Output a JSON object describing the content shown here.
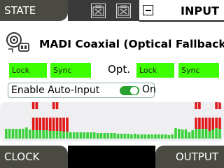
{
  "tabs": {
    "state": "STATE",
    "clock": "CLOCK",
    "output": "OUTPUT",
    "input": "INPUT"
  },
  "device": {
    "name": "MADI Coaxial (Optical Fallback)",
    "icon": "coaxial-connector-icon"
  },
  "status": {
    "primary": [
      "Lock",
      "Sync"
    ],
    "optical_label": "Opt.",
    "optical": [
      "Lock",
      "Sync"
    ]
  },
  "auto_input": {
    "label": "Enable Auto-Input",
    "state": "On",
    "enabled": true
  },
  "colors": {
    "tab_bg": "#4a4a43",
    "status_green": "#3dff00",
    "meter_red": "#e0181a",
    "meter_green": "#3bd13b",
    "toggle_on": "#28a12f"
  },
  "meters": {
    "levels": [
      0.3,
      0.3,
      0.3,
      0.3,
      0.3,
      0.3,
      0.35,
      0.28,
      0.27,
      0.26,
      0.26,
      0.25,
      0.25,
      0.24,
      0.24,
      0.24,
      0.23,
      0.22,
      0.21,
      0.2,
      0.2,
      0.2,
      0.2,
      0.2,
      0.2,
      0.19,
      0.19,
      0.18,
      0.18,
      0.17,
      0.17,
      0.17,
      0.17,
      0.16,
      0.16,
      0.15,
      0.15,
      0.14,
      0.15,
      0.14,
      0.14,
      0.13,
      0.14,
      0.13,
      0.12,
      0.12,
      0.13,
      0.12,
      0.11,
      0.12,
      0.32,
      0.3,
      0.28,
      0.28,
      0.2,
      0.27,
      0.3,
      0.3,
      0.3,
      0.3,
      0.24,
      0.28,
      0.33,
      0.3
    ],
    "red_peaks": [
      8,
      9,
      10,
      11,
      12,
      13,
      14,
      15,
      16,
      17,
      18,
      56,
      57,
      58,
      59,
      60,
      61,
      62,
      63
    ],
    "clip_top": [
      8,
      9,
      14,
      15,
      56,
      57,
      62,
      63
    ]
  }
}
